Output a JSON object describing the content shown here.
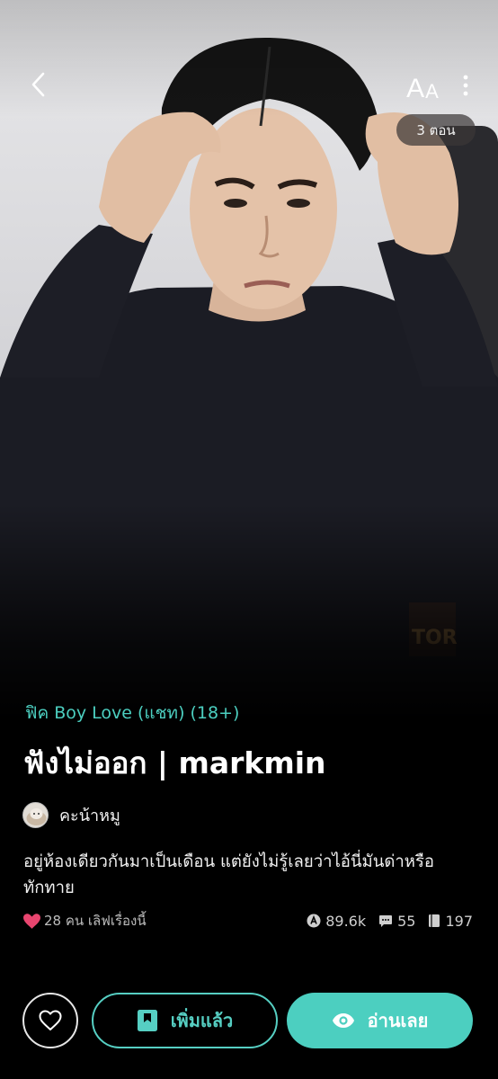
{
  "header": {
    "font_size_big": "A",
    "font_size_small": "A",
    "episodes": "3 ตอน"
  },
  "story": {
    "category": "ฟิค Boy Love (แชท) (18+)",
    "title": "ฟังไม่ออก | markmin",
    "author": "คะน้าหมู",
    "synopsis_line1": "อยู่ห้องเดียวกันมาเป็นเดือน แต่ยังไม่รู้เลยว่าไอ้นี่มันด่าหรือ",
    "synopsis_line2": "ทักทาย",
    "likes": "28 คน เลิฟเรื่องนี้"
  },
  "stats": {
    "views": "89.6k",
    "comments": "55",
    "chapters": "197"
  },
  "actions": {
    "added_label": "เพิ่มแล้ว",
    "read_label": "อ่านเลย"
  },
  "colors": {
    "accent": "#4ccfc0",
    "heart": "#e8456f",
    "background": "#000000"
  },
  "icons": {
    "back": "back-chevron-icon",
    "more": "more-vertical-icon",
    "heart": "heart-icon",
    "views": "views-icon",
    "comments": "comment-icon",
    "chapters": "book-icon",
    "bookmark": "bookmark-icon",
    "eye": "eye-icon"
  }
}
